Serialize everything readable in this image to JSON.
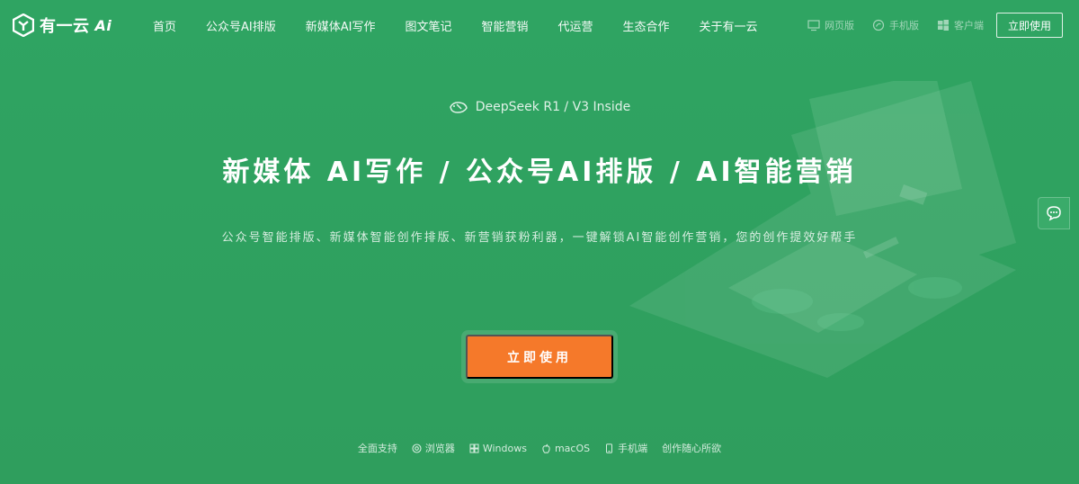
{
  "brand": {
    "name": "有一云",
    "logo_mark": "Ai"
  },
  "nav": {
    "items": [
      {
        "label": "首页"
      },
      {
        "label": "公众号AI排版"
      },
      {
        "label": "新媒体AI写作"
      },
      {
        "label": "图文笔记"
      },
      {
        "label": "智能营销"
      },
      {
        "label": "代运营"
      },
      {
        "label": "生态合作"
      },
      {
        "label": "关于有一云"
      }
    ]
  },
  "header_right": {
    "web": "网页版",
    "mobile": "手机版",
    "client": "客户端",
    "cta": "立即使用"
  },
  "hero": {
    "badge": "DeepSeek R1 / V3 Inside",
    "headline": "新媒体 AI写作 / 公众号AI排版 / AI智能营销",
    "subline": "公众号智能排版、新媒体智能创作排版、新营销获粉利器，一键解锁AI智能创作营销，您的创作提效好帮手",
    "cta": "立即使用"
  },
  "platforms": {
    "items": [
      {
        "label": "全面支持",
        "icon": ""
      },
      {
        "label": "浏览器",
        "icon": "browser-icon"
      },
      {
        "label": "Windows",
        "icon": "windows-icon"
      },
      {
        "label": "macOS",
        "icon": "apple-icon"
      },
      {
        "label": "手机端",
        "icon": "phone-icon"
      },
      {
        "label": "创作随心所欲",
        "icon": ""
      }
    ]
  },
  "colors": {
    "background": "#2fa462",
    "cta_orange": "#f5792a"
  }
}
